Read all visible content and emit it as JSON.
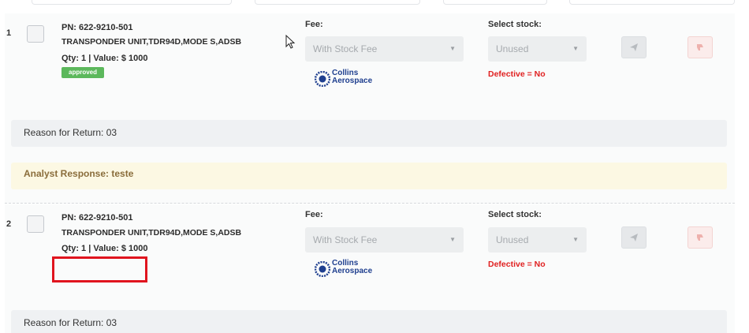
{
  "items": [
    {
      "index": "1",
      "pn": "PN: 622-9210-501",
      "description": "TRANSPONDER UNIT,TDR94D,MODE S,ADSB",
      "qty_value": "Qty: 1 | Value: $ 1000",
      "status_badge": "approved",
      "fee_label": "Fee:",
      "fee_value": "With Stock Fee",
      "stock_label": "Select stock:",
      "stock_value": "Unused",
      "defective": "Defective = No",
      "brand_line1": "Collins",
      "brand_line2": "Aerospace",
      "reason": "Reason for Return: 03",
      "analyst_response": "Analyst Response: teste"
    },
    {
      "index": "2",
      "pn": "PN: 622-9210-501",
      "description": "TRANSPONDER UNIT,TDR94D,MODE S,ADSB",
      "qty_value": "Qty: 1 | Value: $ 1000",
      "fee_label": "Fee:",
      "fee_value": "With Stock Fee",
      "stock_label": "Select stock:",
      "stock_value": "Unused",
      "defective": "Defective = No",
      "brand_line1": "Collins",
      "brand_line2": "Aerospace",
      "reason": "Reason for Return: 03"
    }
  ],
  "icons": {
    "send": "paper-plane-icon",
    "reject": "thumbs-down-icon",
    "caret": "chevron-down-icon",
    "brand": "collins-aerospace-logo"
  },
  "colors": {
    "approved": "#5cb85c",
    "defective_text": "#e02020",
    "analyst_bg": "#fcf8e3",
    "analyst_text": "#8a6d3b",
    "highlight_box": "#e0141e",
    "brand": "#1f3f8f"
  }
}
